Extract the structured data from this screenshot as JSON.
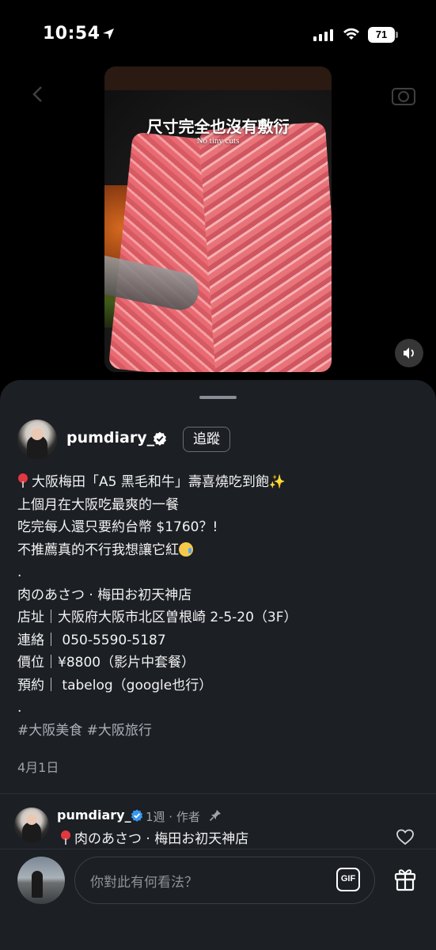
{
  "status_bar": {
    "time": "10:54",
    "battery": "71"
  },
  "video": {
    "caption_zh": "尺寸完全也沒有敷衍",
    "caption_en": "No tiny cuts"
  },
  "post": {
    "username": "pumdiary_",
    "follow_label": "追蹤",
    "caption_lines": [
      "大阪梅田「A5 黑毛和牛」壽喜燒吃到飽",
      "上個月在大阪吃最爽的一餐",
      "吃完每人還只要約台幣 $1760？!",
      "不推薦真的不行我想讓它紅",
      ".",
      "肉のあさつ · 梅田お初天神店",
      "店址｜大阪府大阪市北区曽根崎 2-5-20（3F）",
      "連絡｜ 050-5590-5187",
      "價位｜¥8800（影片中套餐）",
      "預約｜ tabelog（google也行）",
      ".",
      "#大阪美食 #大阪旅行"
    ],
    "date": "4月1日"
  },
  "comment": {
    "username": "pumdiary_",
    "meta": "1週 · 作者",
    "text": "肉のあさつ · 梅田お初天神店"
  },
  "composer": {
    "placeholder": "你對此有何看法？",
    "gif_label": "GIF"
  },
  "icons": {
    "status": [
      "location-arrow-icon",
      "cellular-signal-icon",
      "wifi-icon",
      "battery-icon"
    ],
    "video": [
      "sound-on-icon"
    ],
    "post": [
      "verified-badge-icon",
      "pin-emoji-icon",
      "sparkles-emoji-icon",
      "crying-face-emoji-icon"
    ],
    "comment": [
      "verified-badge-icon",
      "pinned-icon",
      "heart-icon"
    ],
    "composer": [
      "gif-icon",
      "gift-icon"
    ]
  },
  "colors": {
    "background": "#000000",
    "sheet": "#1c1f24",
    "text": "#f2f2f2",
    "muted": "#9ea3aa",
    "verified": "#3897f0"
  }
}
